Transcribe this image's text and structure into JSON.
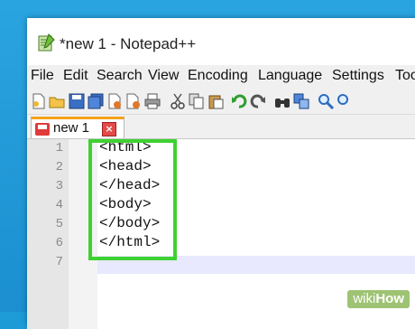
{
  "window": {
    "title": "*new 1 - Notepad++"
  },
  "menubar": {
    "items": [
      "File",
      "Edit",
      "Search",
      "View",
      "Encoding",
      "Language",
      "Settings",
      "Too"
    ]
  },
  "toolbar": {
    "icons": [
      "new-file-icon",
      "open-file-icon",
      "save-icon",
      "save-all-icon",
      "close-icon",
      "close-all-icon",
      "print-icon",
      "cut-icon",
      "copy-icon",
      "paste-icon",
      "undo-icon",
      "redo-icon",
      "find-icon",
      "replace-icon",
      "zoom-in-icon"
    ]
  },
  "tabs": [
    {
      "label": "new 1",
      "close_symbol": "×"
    }
  ],
  "editor": {
    "lines": [
      {
        "number": "1",
        "text": "<html>"
      },
      {
        "number": "2",
        "text": "<head>"
      },
      {
        "number": "3",
        "text": "</head>"
      },
      {
        "number": "4",
        "text": "<body>"
      },
      {
        "number": "5",
        "text": "</body>"
      },
      {
        "number": "6",
        "text": "</html>"
      },
      {
        "number": "7",
        "text": ""
      }
    ],
    "current_line": "6"
  },
  "colors": {
    "desktop": "#1d9bd7",
    "highlight_box": "#3ed132",
    "current_line": "#e8e8ff",
    "tab_accent": "#f6a21b"
  },
  "watermark": {
    "prefix": "wiki",
    "suffix": "How"
  }
}
